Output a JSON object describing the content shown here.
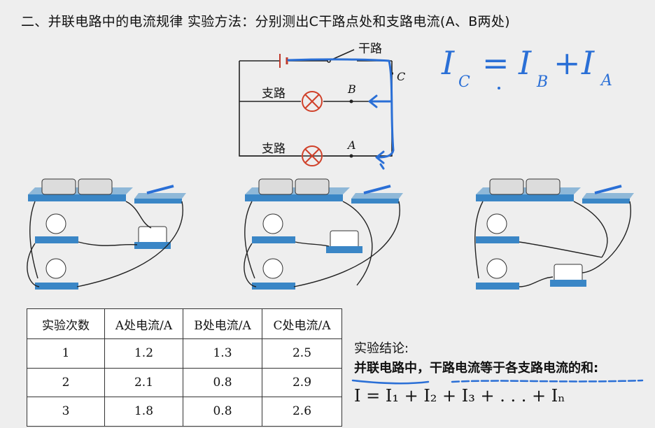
{
  "title": "二、并联电路中的电流规律 实验方法：分别测出C干路点处和支路电流(A、B两处)",
  "circuit": {
    "trunk_label": "干路",
    "point_c": "C",
    "point_b": "B",
    "point_a": "A",
    "branch1_label": "支路",
    "branch2_label": "支路"
  },
  "handwritten": {
    "ic": "I",
    "ic_sub": "C",
    "eq": "=",
    "ib": "I",
    "ib_sub": "B",
    "plus": "+",
    "ia": "I",
    "ia_sub": "A"
  },
  "table": {
    "headers": [
      "实验次数",
      "A处电流/A",
      "B处电流/A",
      "C处电流/A"
    ],
    "rows": [
      [
        "1",
        "1.2",
        "1.3",
        "2.5"
      ],
      [
        "2",
        "2.1",
        "0.8",
        "2.9"
      ],
      [
        "3",
        "1.8",
        "0.8",
        "2.6"
      ]
    ]
  },
  "conclusion": {
    "label": "实验结论:",
    "text": "并联电路中，干路电流等于各支路电流的和:",
    "formula": "I = I₁ + I₂ + I₃ + . . . + Iₙ"
  },
  "colors": {
    "ink_blue": "#2a6fd6",
    "lamp_red": "#d0412a",
    "base_blue": "#3a86c6"
  }
}
